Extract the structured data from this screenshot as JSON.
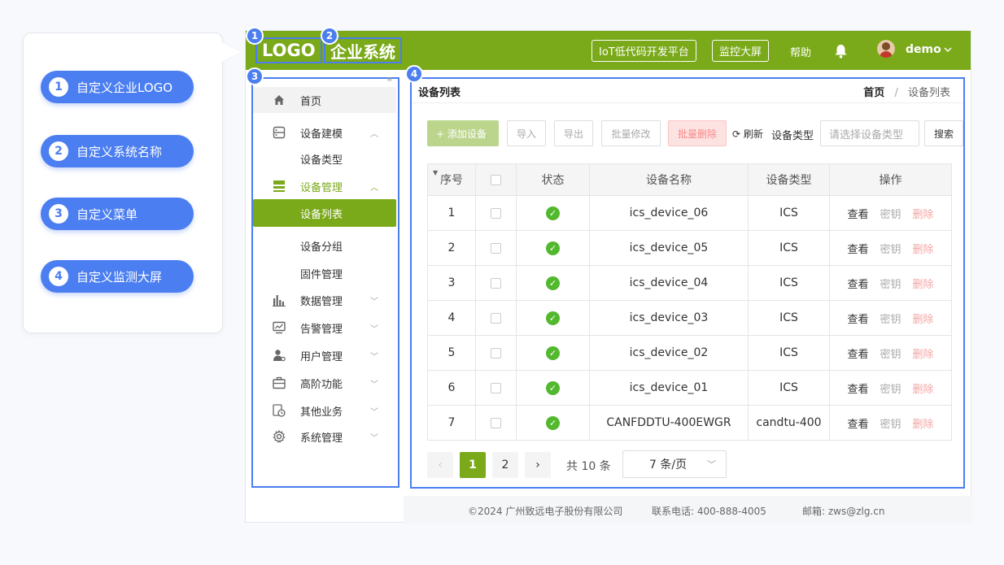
{
  "callouts": [
    {
      "num": "1",
      "label": "自定义企业LOGO"
    },
    {
      "num": "2",
      "label": "自定义系统名称"
    },
    {
      "num": "3",
      "label": "自定义菜单"
    },
    {
      "num": "4",
      "label": "自定义监测大屏"
    }
  ],
  "header": {
    "logo": "LOGO",
    "system_name": "企业系统",
    "badge_logo": "1",
    "badge_name": "2",
    "badge_menu": "3",
    "badge_main": "4",
    "iot_platform": "IoT低代码开发平台",
    "monitor_screen": "监控大屏",
    "help": "帮助",
    "user": "demo",
    "accent": "#7aa919"
  },
  "sidebar": {
    "items": [
      {
        "label": "首页",
        "icon": "home-icon"
      },
      {
        "label": "设备建模",
        "icon": "model-icon"
      },
      {
        "label": "设备管理",
        "icon": "device-icon"
      },
      {
        "label": "数据管理",
        "icon": "bar-chart-icon"
      },
      {
        "label": "告警管理",
        "icon": "monitor-icon"
      },
      {
        "label": "用户管理",
        "icon": "user-icon"
      },
      {
        "label": "高阶功能",
        "icon": "briefcase-icon"
      },
      {
        "label": "其他业务",
        "icon": "clock-icon"
      },
      {
        "label": "系统管理",
        "icon": "gear-icon"
      }
    ],
    "sub_modeling": [
      "设备类型"
    ],
    "sub_device": [
      "设备列表",
      "设备分组",
      "固件管理"
    ]
  },
  "main": {
    "title": "设备列表",
    "breadcrumb_home": "首页",
    "breadcrumb_sep": "/",
    "breadcrumb_current": "设备列表",
    "toolbar": {
      "add": "+ 添加设备",
      "import": "导入",
      "export": "导出",
      "batch_edit": "批量修改",
      "batch_delete": "批量删除",
      "refresh": "刷新",
      "type_label": "设备类型",
      "type_placeholder": "请选择设备类型",
      "search": "搜索"
    },
    "columns": [
      "序号",
      "",
      "状态",
      "设备名称",
      "设备类型",
      "操作"
    ],
    "rows": [
      {
        "idx": "1",
        "name": "ics_device_06",
        "type": "ICS"
      },
      {
        "idx": "2",
        "name": "ics_device_05",
        "type": "ICS"
      },
      {
        "idx": "3",
        "name": "ics_device_04",
        "type": "ICS"
      },
      {
        "idx": "4",
        "name": "ics_device_03",
        "type": "ICS"
      },
      {
        "idx": "5",
        "name": "ics_device_02",
        "type": "ICS"
      },
      {
        "idx": "6",
        "name": "ics_device_01",
        "type": "ICS"
      },
      {
        "idx": "7",
        "name": "CANFDDTU-400EWGR",
        "type": "candtu-400"
      }
    ],
    "actions": {
      "view": "查看",
      "key": "密钥",
      "delete": "删除"
    },
    "pager": {
      "prev": "‹",
      "next": "›",
      "pages": [
        "1",
        "2"
      ],
      "current": "1",
      "total": "共 10 条",
      "page_size": "7 条/页"
    }
  },
  "footer": {
    "copyright": "©2024 广州致远电子股份有限公司",
    "phone": "联系电话:  400-888-4005",
    "email": "邮箱:  zws@zlg.cn"
  }
}
